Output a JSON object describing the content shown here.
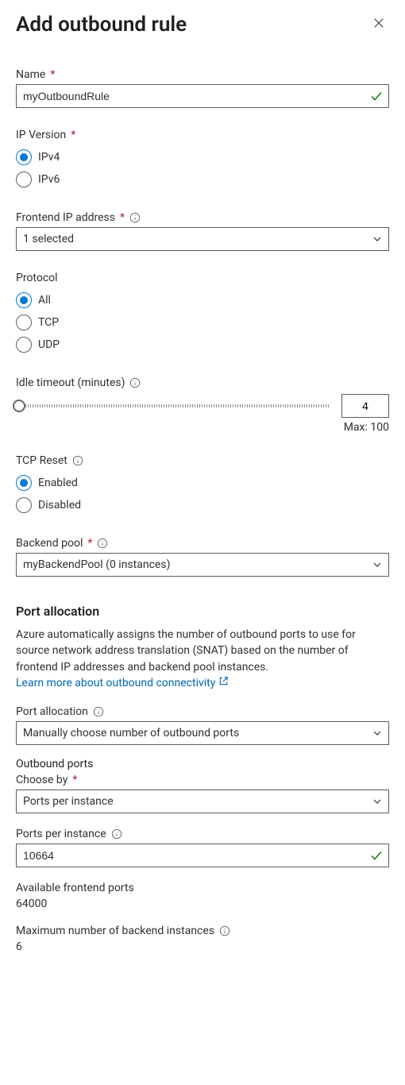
{
  "title": "Add outbound rule",
  "name_field": {
    "label": "Name",
    "value": "myOutboundRule"
  },
  "ip_version": {
    "label": "IP Version",
    "options": [
      "IPv4",
      "IPv6"
    ],
    "selected": "IPv4"
  },
  "frontend_ip": {
    "label": "Frontend IP address",
    "value": "1 selected"
  },
  "protocol": {
    "label": "Protocol",
    "options": [
      "All",
      "TCP",
      "UDP"
    ],
    "selected": "All"
  },
  "idle_timeout": {
    "label": "Idle timeout (minutes)",
    "value": "4",
    "max_label": "Max: 100"
  },
  "tcp_reset": {
    "label": "TCP Reset",
    "options": [
      "Enabled",
      "Disabled"
    ],
    "selected": "Enabled"
  },
  "backend_pool": {
    "label": "Backend pool",
    "value": "myBackendPool (0 instances)"
  },
  "port_allocation": {
    "heading": "Port allocation",
    "description": "Azure automatically assigns the number of outbound ports to use for source network address translation (SNAT) based on the number of frontend IP addresses and backend pool instances.",
    "link_text": "Learn more about outbound connectivity",
    "field_label": "Port allocation",
    "field_value": "Manually choose number of outbound ports"
  },
  "outbound_ports": {
    "heading": "Outbound ports",
    "choose_by_label": "Choose by",
    "choose_by_value": "Ports per instance",
    "ports_per_instance_label": "Ports per instance",
    "ports_per_instance_value": "10664",
    "available_label": "Available frontend ports",
    "available_value": "64000",
    "max_instances_label": "Maximum number of backend instances",
    "max_instances_value": "6"
  }
}
